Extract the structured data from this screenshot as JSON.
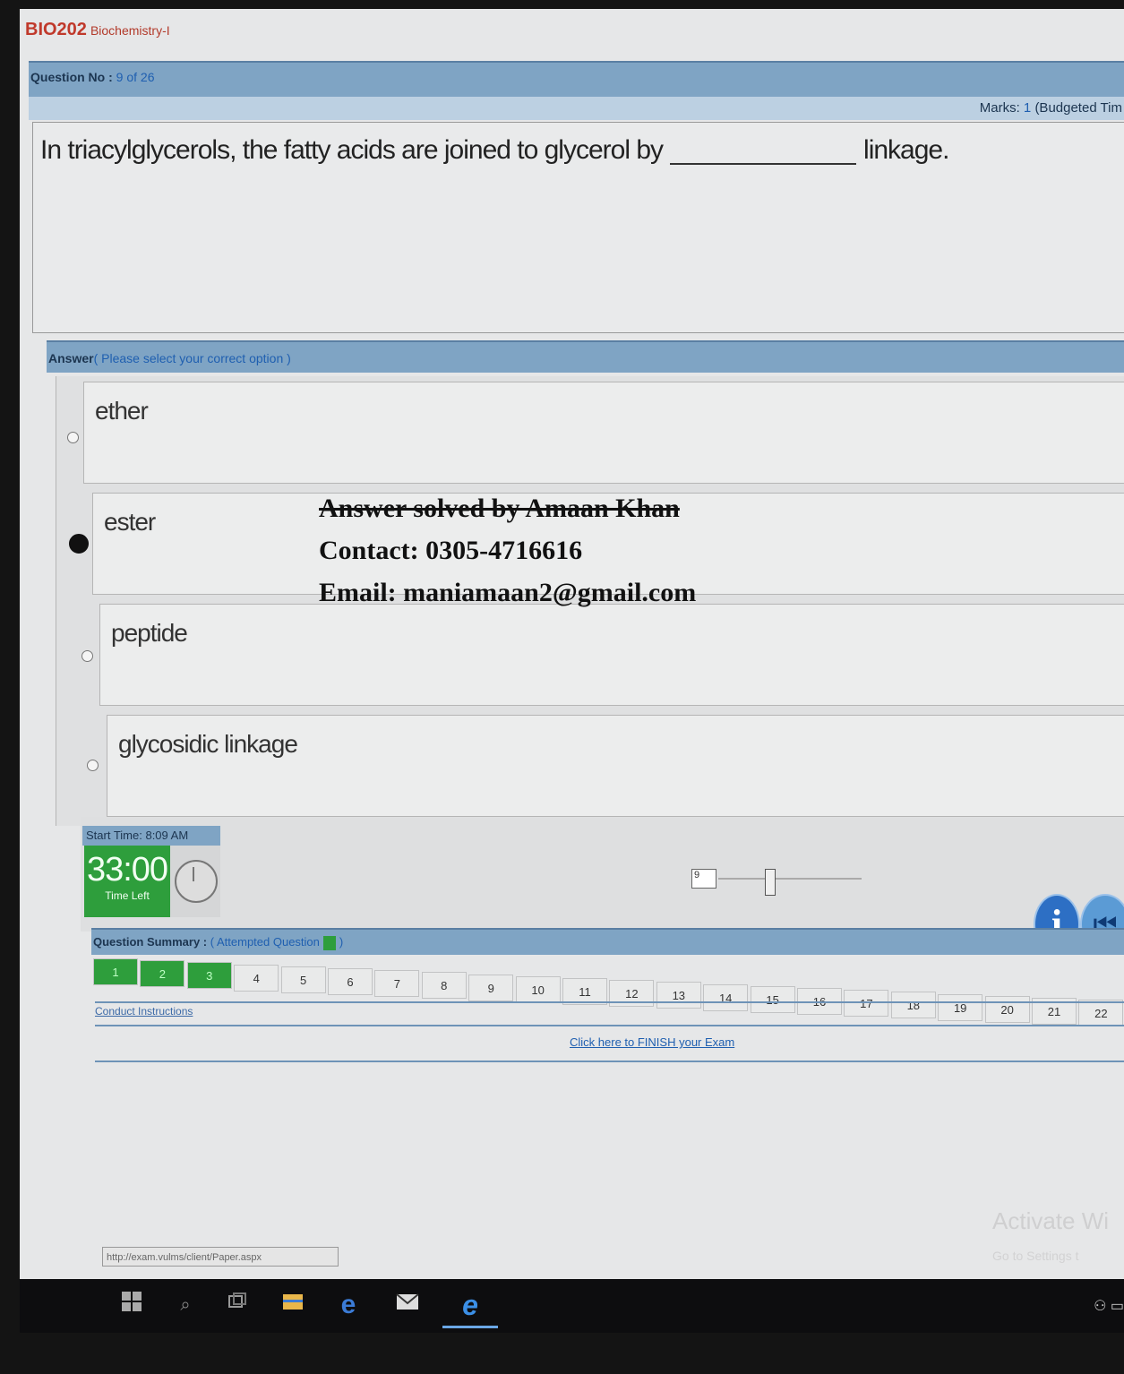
{
  "course": {
    "code": "BIO202",
    "name": "Biochemistry-I"
  },
  "question": {
    "label": "Question No :",
    "number": "9 of 26",
    "text_before": "In triacylglycerols, the fatty acids are joined to glycerol by",
    "text_after": "linkage.",
    "marks_label": "Marks:",
    "marks": "1",
    "budgeted": "(Budgeted Tim"
  },
  "answer": {
    "label": "Answer",
    "hint": "( Please select your correct option )",
    "options": [
      "ether",
      "ester",
      "peptide",
      "glycosidic linkage"
    ],
    "selected_index": 1
  },
  "overlay": {
    "line1": "Answer solved by Amaan Khan",
    "line2": "Contact: 0305-4716616",
    "line3": "Email: maniamaan2@gmail.com"
  },
  "timer": {
    "start_label": "Start Time: 8:09 AM",
    "time_left": "33:00",
    "time_left_label": "Time Left"
  },
  "slider": {
    "value": "9"
  },
  "summary": {
    "label": "Question Summary :",
    "hint": "( Attempted Question",
    "close": ")",
    "questions": [
      "1",
      "2",
      "3",
      "4",
      "5",
      "6",
      "7",
      "8",
      "9",
      "10",
      "11",
      "12",
      "13",
      "14",
      "15",
      "16",
      "17",
      "18",
      "19",
      "20",
      "21",
      "22"
    ],
    "attempted_count": 3
  },
  "links": {
    "instructions": "Conduct Instructions",
    "finish": "Click here to FINISH your Exam"
  },
  "statusbar": {
    "url": "http://exam.vulms/client/Paper.aspx"
  },
  "watermark": {
    "title": "Activate Wi",
    "sub": "Go to Settings t"
  },
  "colors": {
    "header_bar": "#7fa4c4",
    "timer_green": "#2e9e3c",
    "course_red": "#c0392b",
    "link_blue": "#1f5fb0"
  }
}
